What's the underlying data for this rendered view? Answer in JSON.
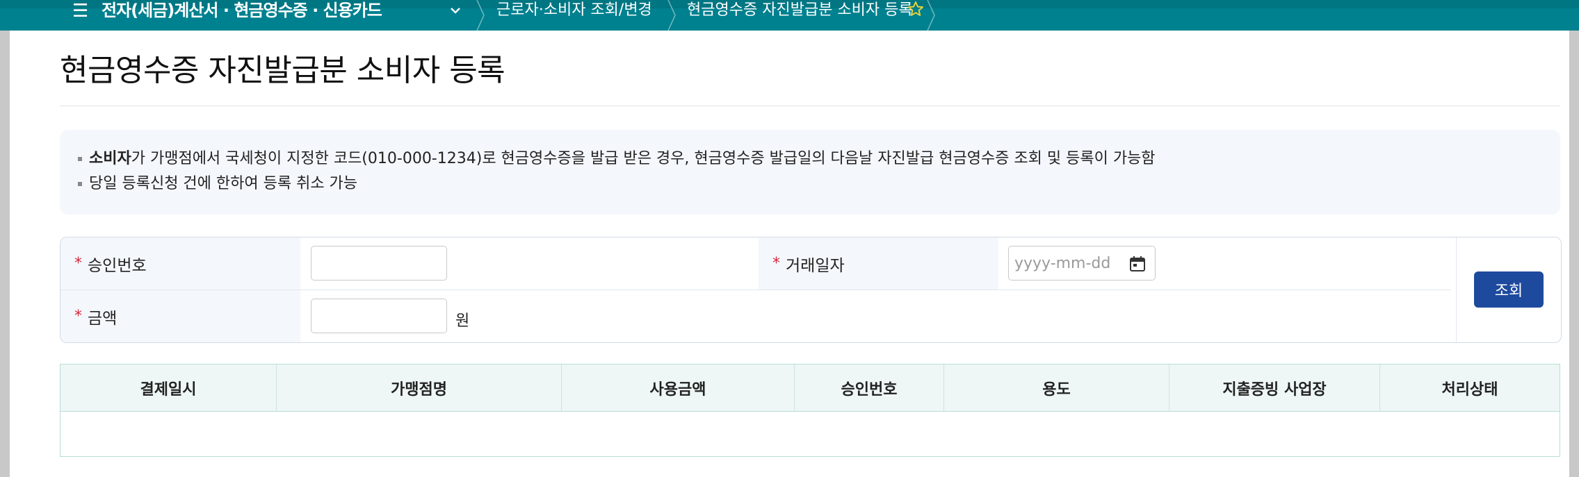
{
  "nav": {
    "section": "전자(세금)계산서 · 현금영수증 · 신용카드",
    "crumbs": [
      "근로자·소비자 조회/변경",
      "현금영수증 자진발급분 소비자 등록"
    ],
    "icons": {
      "menu": "hamburger-icon",
      "dropdown": "chevron-down-icon",
      "favorite": "star-icon"
    },
    "colors": {
      "bar": "#00818f",
      "star": "#e8d23a"
    }
  },
  "page": {
    "title": "현금영수증 자진발급분 소비자 등록"
  },
  "notice": {
    "line1_strong": "소비자",
    "line1_rest": "가 가맹점에서 국세청이 지정한 코드(010-000-1234)로 현금영수증을 발급 받은 경우, 현금영수증 발급일의 다음날 자진발급 현금영수증 조회 및 등록이 가능함",
    "line2": "당일 등록신청 건에 한하여 등록 취소 가능"
  },
  "form": {
    "required_mark": "*",
    "approval_label": "승인번호",
    "approval_value": "",
    "date_label": "거래일자",
    "date_placeholder": "yyyy-mm-dd",
    "amount_label": "금액",
    "amount_value": "",
    "amount_unit": "원",
    "search_button": "조회",
    "colors": {
      "required": "#d6283a",
      "button": "#1e4a9e"
    }
  },
  "table": {
    "columns": [
      "결제일시",
      "가맹점명",
      "사용금액",
      "승인번호",
      "용도",
      "지출증빙 사업장",
      "처리상태"
    ],
    "rows": []
  }
}
